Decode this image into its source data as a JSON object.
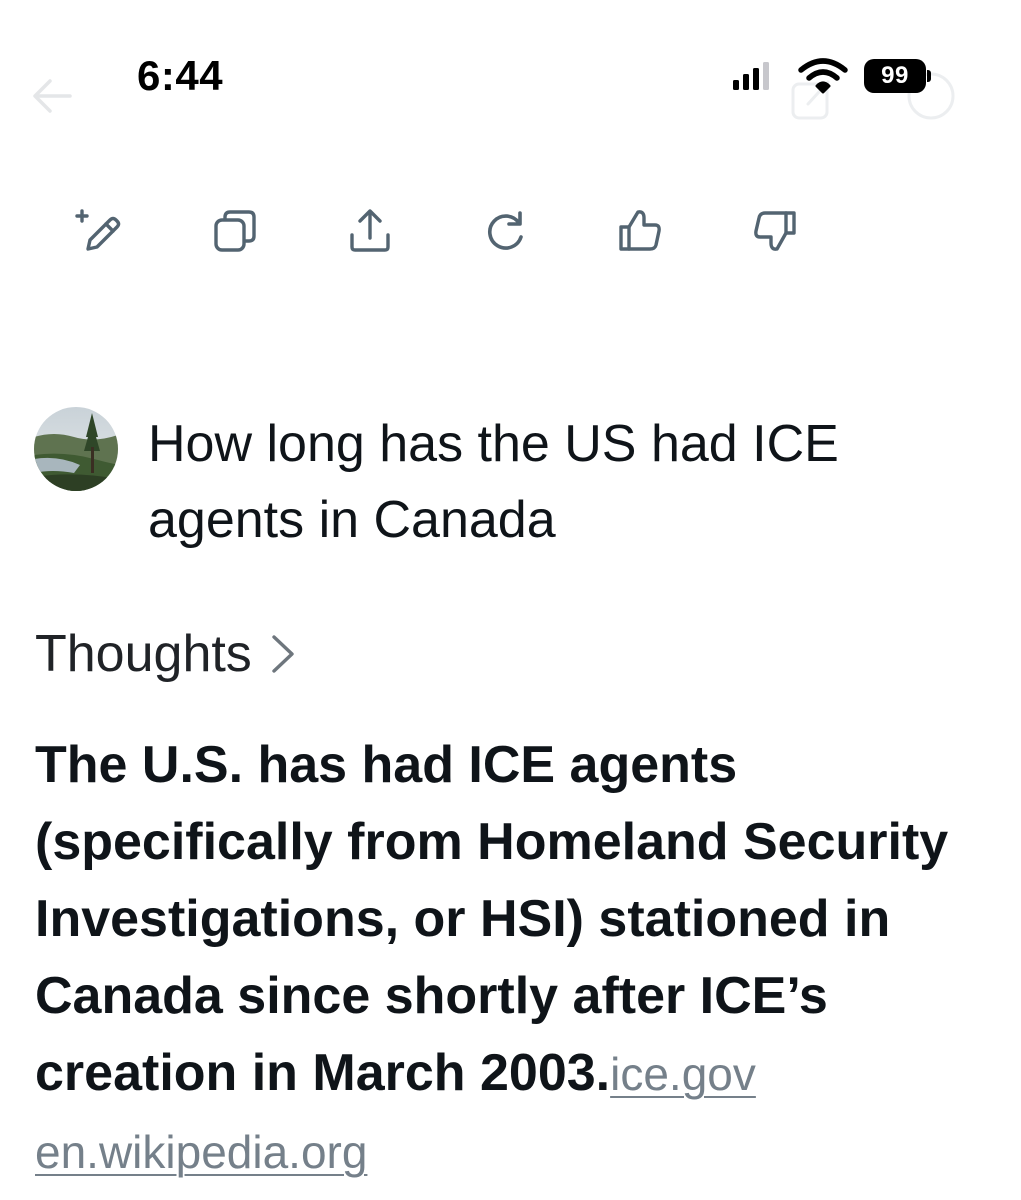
{
  "status_bar": {
    "time": "6:44",
    "battery_level": "99",
    "signal_icon": "cellular-signal-icon",
    "wifi_icon": "wifi-icon"
  },
  "toolbar": {
    "buttons": [
      {
        "icon": "edit-pencil-icon",
        "action": "edit"
      },
      {
        "icon": "copy-icon",
        "action": "copy"
      },
      {
        "icon": "share-icon",
        "action": "share"
      },
      {
        "icon": "regenerate-icon",
        "action": "regenerate"
      },
      {
        "icon": "thumbs-up-icon",
        "action": "like"
      },
      {
        "icon": "thumbs-down-icon",
        "action": "dislike"
      }
    ]
  },
  "user_message": {
    "avatar_icon": "user-avatar-landscape",
    "text": "How long has the US had ICE agents in Canada"
  },
  "thoughts": {
    "label": "Thoughts"
  },
  "answer": {
    "text": "The U.S. has had ICE agents (specifically from Homeland Security Investigations, or HSI) stationed in Canada since shortly after ICE’s creation in March 2003.",
    "sources": [
      "ice.gov",
      "en.wikipedia.org"
    ]
  },
  "colors": {
    "text": "#0f1419",
    "icon": "#536471",
    "link": "#75808a",
    "background": "#ffffff"
  }
}
